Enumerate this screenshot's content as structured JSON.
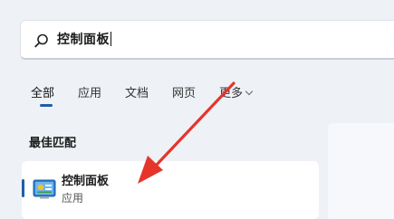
{
  "search": {
    "query": "控制面板"
  },
  "tabs": [
    {
      "label": "全部"
    },
    {
      "label": "应用"
    },
    {
      "label": "文档"
    },
    {
      "label": "网页"
    },
    {
      "label": "更多"
    }
  ],
  "best_match": {
    "title": "最佳匹配",
    "result": {
      "title": "控制面板",
      "subtitle": "应用",
      "icon": "control-panel-icon"
    }
  },
  "annotation": {
    "arrow_color": "#e5352b"
  },
  "colors": {
    "accent": "#1f5ea8",
    "background": "#eef1f6"
  }
}
